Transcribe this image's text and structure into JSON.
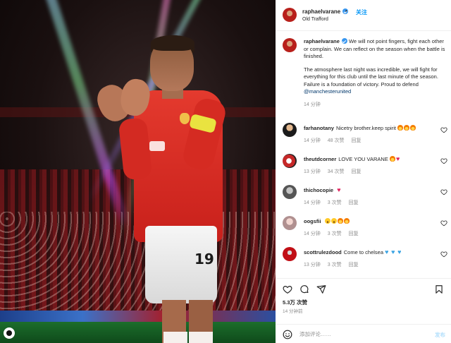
{
  "post": {
    "username": "raphaelvarane",
    "follow_label": "关注",
    "separator": "•",
    "location": "Old Trafford",
    "caption_p1": "We will not point fingers, fight each other or complain. We can reflect on the season when the battle is finished.",
    "caption_p2": "The atmosphere last night was incredible, we will fight for everything for this club until the last minute of the season. Failure is a foundation of victory. Proud to defend ",
    "caption_mention": "@manchesterunited",
    "caption_time": "14 分钟",
    "jersey_number": "19",
    "likes": "5.3万 次赞",
    "post_time": "14 分钟前",
    "comment_placeholder": "添加评论……",
    "post_button": "发布"
  },
  "comments": [
    {
      "username": "farhanotany",
      "text": "Nicetry brother.keep spirit",
      "emojis": [
        "fire",
        "fire",
        "fire"
      ],
      "time": "14 分钟",
      "likes": "48 次赞",
      "reply": "回复"
    },
    {
      "username": "theutdcorner",
      "text": "LOVE YOU VARANE",
      "emojis": [
        "fire",
        "heart"
      ],
      "time": "13 分钟",
      "likes": "34 次赞",
      "reply": "回复"
    },
    {
      "username": "thichocopie",
      "text": "",
      "emojis": [
        "heart"
      ],
      "time": "14 分钟",
      "likes": "3 次赞",
      "reply": "回复"
    },
    {
      "username": "oogsfii",
      "text": "",
      "emojis": [
        "laugh",
        "laugh",
        "fire",
        "fire"
      ],
      "time": "14 分钟",
      "likes": "3 次赞",
      "reply": "回复"
    },
    {
      "username": "scottrulezdood",
      "text": "Come to chelsea",
      "emojis": [
        "blueheart",
        "blueheart",
        "blueheart"
      ],
      "time": "13 分钟",
      "likes": "3 次赞",
      "reply": "回复"
    }
  ],
  "icons": {
    "like": "heart-icon",
    "comment": "comment-icon",
    "share": "send-icon",
    "save": "bookmark-icon",
    "emoji": "smiley-icon",
    "verified": "verified-badge-icon"
  },
  "colors": {
    "link": "#0095f6",
    "verified": "#3897f0",
    "muted": "#8e8e8e"
  }
}
